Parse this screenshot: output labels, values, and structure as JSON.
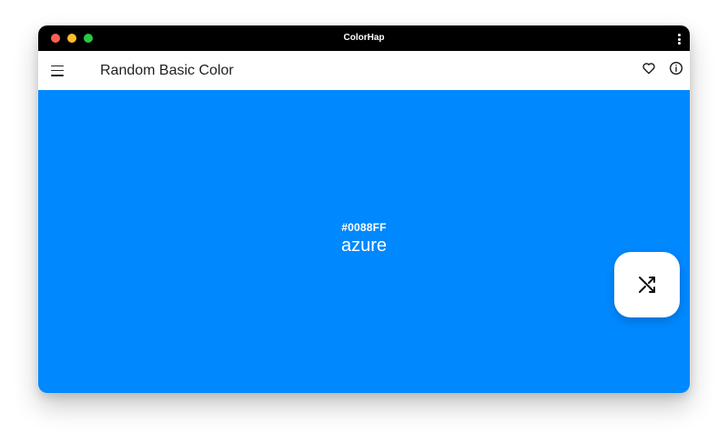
{
  "window": {
    "title": "ColorHap"
  },
  "appbar": {
    "title": "Random Basic Color",
    "menu_icon": "hamburger-icon",
    "actions": [
      "heart-icon",
      "info-icon"
    ]
  },
  "color": {
    "hex": "#0088FF",
    "name": "azure",
    "background": "#0088ff"
  },
  "fab": {
    "icon": "shuffle-icon"
  },
  "theme": {
    "titlebar_bg": "#000000",
    "appbar_bg": "#ffffff",
    "close": "#ff5f57",
    "minimize": "#febc2e",
    "zoom": "#28c840"
  }
}
